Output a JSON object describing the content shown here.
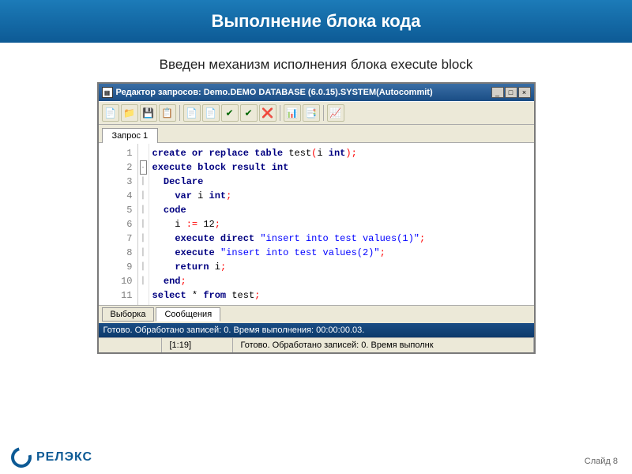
{
  "slide": {
    "title": "Выполнение блока кода",
    "subtitle": "Введен механизм исполнения блока execute block",
    "footer_label": "Слайд",
    "footer_num": "8"
  },
  "window": {
    "title": "Редактор запросов: Demo.DEMO DATABASE (6.0.15).SYSTEM(Autocommit)",
    "btns": {
      "min": "_",
      "max": "□",
      "close": "×"
    }
  },
  "toolbar_icons": [
    "📄",
    "📁",
    "💾",
    "📋",
    "",
    "📄",
    "📄",
    "✔",
    "✔",
    "❌",
    "",
    "📊",
    "📑",
    "",
    "📈"
  ],
  "tabs": {
    "query": "Запрос 1"
  },
  "code": {
    "lines": [
      {
        "n": "1",
        "html": "<span class='kw'>create or replace table</span> test<span class='punct'>(</span>i <span class='kw'>int</span><span class='punct'>);</span>"
      },
      {
        "n": "2",
        "html": "<span class='kw'>execute block result int</span>"
      },
      {
        "n": "3",
        "html": "  <span class='kw'>Declare</span>"
      },
      {
        "n": "4",
        "html": "    <span class='kw'>var</span> i <span class='kw'>int</span><span class='punct'>;</span>"
      },
      {
        "n": "5",
        "html": "  <span class='kw'>code</span>"
      },
      {
        "n": "6",
        "html": "    i <span class='punct'>:=</span> 12<span class='punct'>;</span>"
      },
      {
        "n": "7",
        "html": "    <span class='kw'>execute direct</span> <span class='str'>\"insert into test values(1)\"</span><span class='punct'>;</span>"
      },
      {
        "n": "8",
        "html": "    <span class='kw'>execute</span> <span class='str'>\"insert into test values(2)\"</span><span class='punct'>;</span>"
      },
      {
        "n": "9",
        "html": "    <span class='kw'>return</span> i<span class='punct'>;</span>"
      },
      {
        "n": "10",
        "html": "  <span class='kw'>end</span><span class='punct'>;</span>"
      },
      {
        "n": "11",
        "html": "<span class='kw'>select</span> * <span class='kw'>from</span> test<span class='punct'>;</span>"
      }
    ]
  },
  "bottom_tabs": {
    "selection": "Выборка",
    "messages": "Сообщения"
  },
  "message": "Готово. Обработано записей: 0. Время выполнения: 00:00:00.03.",
  "status": {
    "cursor": "[1:19]",
    "text": "Готово. Обработано записей: 0. Время выполнк"
  },
  "logo": {
    "name": "РЕЛЭКС"
  }
}
